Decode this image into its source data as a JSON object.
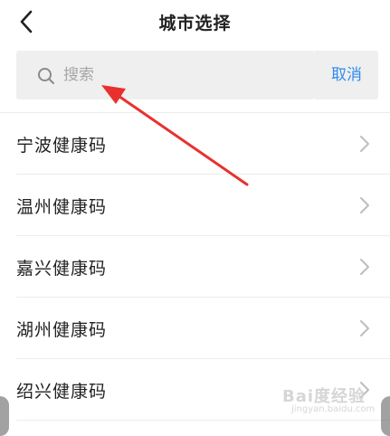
{
  "header": {
    "back_icon": "chevron-left-icon",
    "title": "城市选择"
  },
  "search": {
    "icon": "search-icon",
    "placeholder": "搜索",
    "value": "",
    "cancel_label": "取消"
  },
  "cities": [
    {
      "name": "宁波健康码"
    },
    {
      "name": "温州健康码"
    },
    {
      "name": "嘉兴健康码"
    },
    {
      "name": "湖州健康码"
    },
    {
      "name": "绍兴健康码"
    }
  ],
  "colors": {
    "accent": "#2d8cf0",
    "search_bg": "#efefef",
    "annotation_arrow": "#e8312f"
  },
  "watermark": {
    "text": "Bai度经验",
    "sub": "jingyan.baidu.com"
  }
}
